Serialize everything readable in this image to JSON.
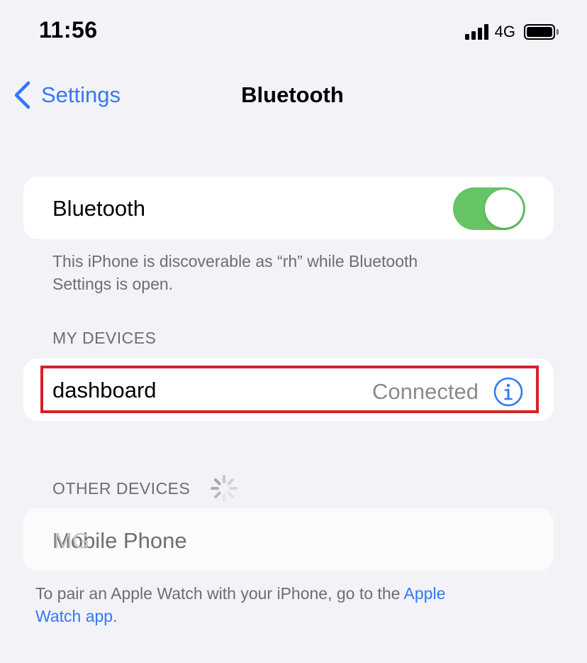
{
  "status_bar": {
    "time": "11:56",
    "network": "4G",
    "signal_bars": 4,
    "battery_level": 1.0
  },
  "nav": {
    "back_label": "Settings",
    "title": "Bluetooth"
  },
  "bluetooth_toggle": {
    "label": "Bluetooth",
    "enabled": true,
    "on_color": "#65c466"
  },
  "discoverable_note": {
    "line1": "This iPhone is discoverable as “rh” while Bluetooth",
    "line2": "Settings is open."
  },
  "my_devices": {
    "header": "MY DEVICES",
    "devices": [
      {
        "name": "dashboard",
        "status": "Connected"
      }
    ]
  },
  "other_devices": {
    "header": "OTHER DEVICES",
    "devices": [
      {
        "name": "Mobile Phone"
      }
    ]
  },
  "ghost_text": "MG",
  "watch_note": {
    "text_before": "To pair an Apple Watch with your iPhone, go to the ",
    "link_part1": "Apple",
    "link_part2": "Watch app",
    "text_after": "."
  },
  "colors": {
    "accent": "#3478f6",
    "background": "#f2f2f7",
    "highlight": "#d3222a",
    "secondary_text": "#6d6d72"
  }
}
